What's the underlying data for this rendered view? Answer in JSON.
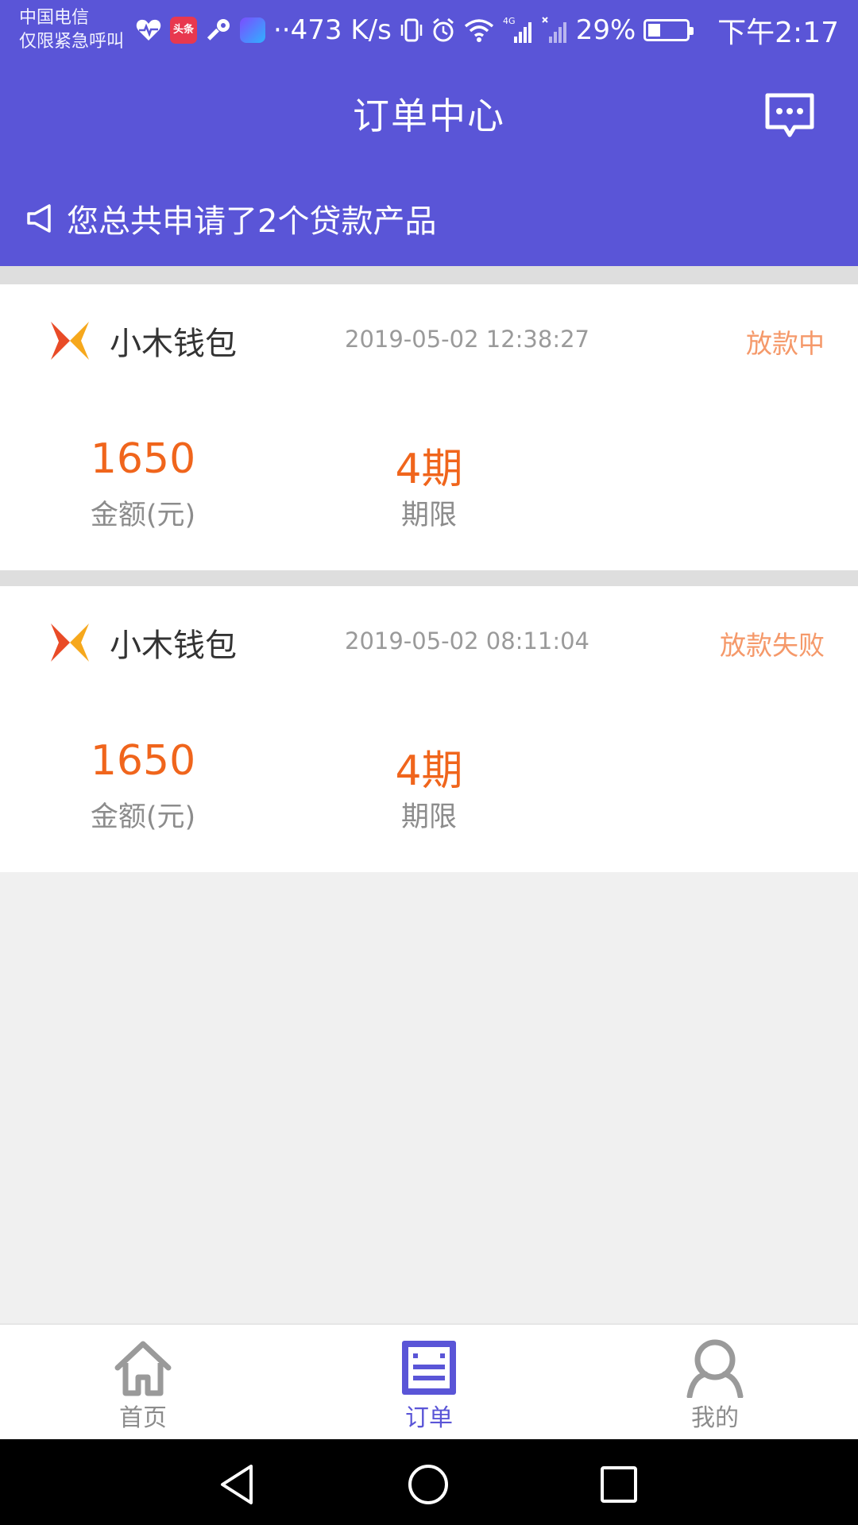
{
  "status_bar": {
    "carrier_line1": "中国电信",
    "carrier_line2": "仅限紧急呼叫",
    "net_speed": "··473 K/s",
    "battery_percent": "29%",
    "time": "下午2:17",
    "toutiao_label": "头条",
    "network_type": "4G",
    "icons": [
      "heart-monitor-icon",
      "toutiao-app-icon",
      "key-icon",
      "video-app-icon",
      "vibrate-icon",
      "alarm-icon",
      "wifi-icon",
      "signal-icon",
      "signal-no-sim-icon",
      "battery-icon"
    ]
  },
  "header": {
    "title": "订单中心",
    "message_icon": "message-icon",
    "notice_icon": "megaphone-icon",
    "notice_text": "您总共申请了2个贷款产品"
  },
  "orders": [
    {
      "product_name": "小木钱包",
      "time": "2019-05-02 12:38:27",
      "status": "放款中",
      "amount": "1650",
      "amount_label": "金额(元)",
      "term": "4期",
      "term_label": "期限"
    },
    {
      "product_name": "小木钱包",
      "time": "2019-05-02 08:11:04",
      "status": "放款失败",
      "amount": "1650",
      "amount_label": "金额(元)",
      "term": "4期",
      "term_label": "期限"
    }
  ],
  "tabs": [
    {
      "label": "首页",
      "icon": "home-icon",
      "active": false
    },
    {
      "label": "订单",
      "icon": "orders-icon",
      "active": true
    },
    {
      "label": "我的",
      "icon": "profile-icon",
      "active": false
    }
  ],
  "colors": {
    "primary": "#5a55d7",
    "amount": "#f0651c",
    "status": "#f5996a",
    "muted_text": "#8c8c8c"
  }
}
